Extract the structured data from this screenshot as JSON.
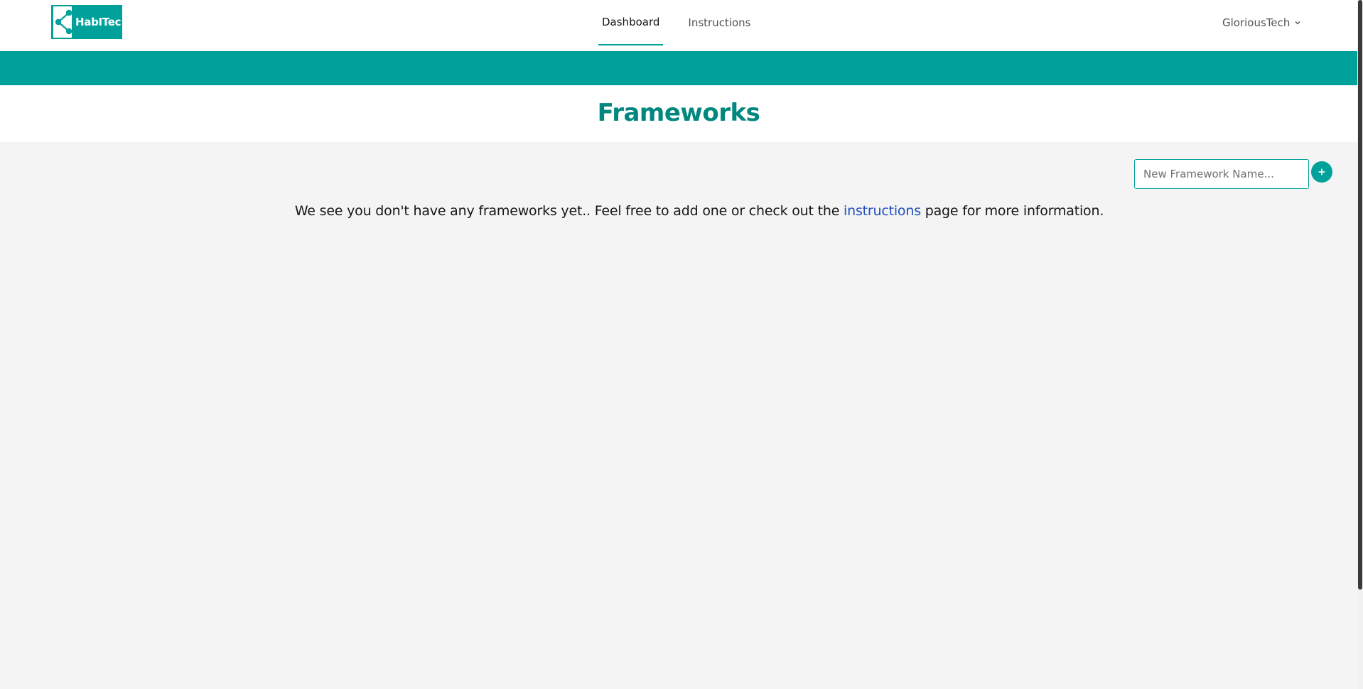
{
  "header": {
    "logo_text": "HabITec",
    "nav": [
      {
        "label": "Dashboard",
        "active": true
      },
      {
        "label": "Instructions",
        "active": false
      }
    ],
    "user_name": "GloriousTech"
  },
  "main": {
    "title": "Frameworks",
    "new_framework_placeholder": "New Framework Name...",
    "add_button_label": "+",
    "empty_message": {
      "before": "We see you don't have any frameworks yet.. Feel free to add one or check out the ",
      "link": "instructions",
      "after": " page for more information."
    }
  },
  "colors": {
    "accent": "#00a19a",
    "title": "#00877f",
    "link": "#1f4fbf"
  }
}
